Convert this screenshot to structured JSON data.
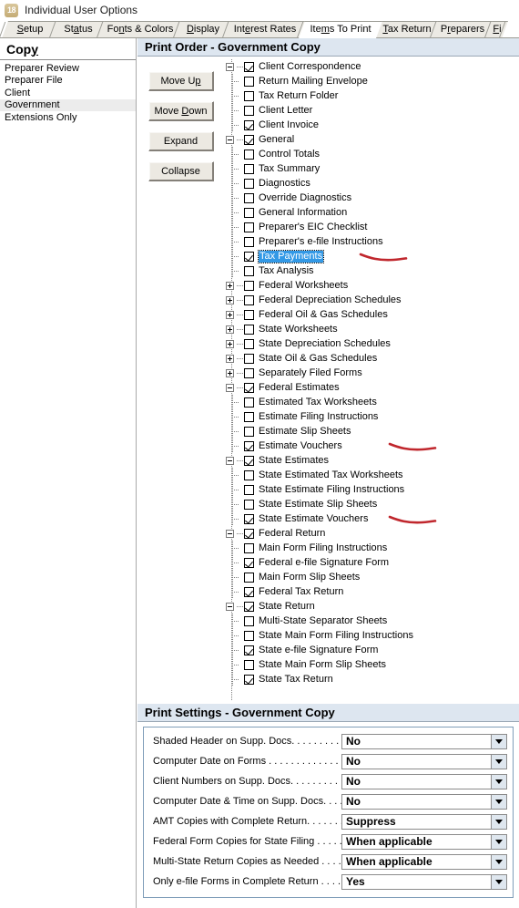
{
  "window": {
    "title": "Individual User Options",
    "icon_name": "app-icon-18",
    "icon_text": "18"
  },
  "tabs": [
    {
      "label": "Setup",
      "accel": "S",
      "active": false
    },
    {
      "label": "Status",
      "accel": "a",
      "active": false
    },
    {
      "label": "Fonts & Colors",
      "accel": "n",
      "active": false
    },
    {
      "label": "Display",
      "accel": "D",
      "active": false
    },
    {
      "label": "Interest Rates",
      "accel": "e",
      "active": false
    },
    {
      "label": "Items To Print",
      "accel": "m",
      "active": true
    },
    {
      "label": "Tax Return",
      "accel": "T",
      "active": false
    },
    {
      "label": "Preparers",
      "accel": "r",
      "active": false
    },
    {
      "label": "Fi",
      "accel": "F",
      "active": false
    }
  ],
  "sidebar": {
    "header": "Copy",
    "header_accel": "y",
    "items": [
      {
        "label": "Preparer Review",
        "selected": false
      },
      {
        "label": "Preparer File",
        "selected": false
      },
      {
        "label": "Client",
        "selected": false
      },
      {
        "label": "Government",
        "selected": true
      },
      {
        "label": "Extensions Only",
        "selected": false
      }
    ]
  },
  "print_order": {
    "title": "Print Order - Government Copy",
    "buttons": [
      {
        "label": "Move Up",
        "accel": "p",
        "name": "move-up-button"
      },
      {
        "label": "Move Down",
        "accel": "D",
        "name": "move-down-button"
      },
      {
        "label": "Expand",
        "accel": "",
        "name": "expand-button"
      },
      {
        "label": "Collapse",
        "accel": "",
        "name": "collapse-button"
      }
    ],
    "tree": [
      {
        "label": "Client Correspondence",
        "level": 0,
        "checked": true,
        "expander": "minus",
        "selected": false,
        "mark": false
      },
      {
        "label": "Return Mailing Envelope",
        "level": 1,
        "checked": false,
        "expander": "none",
        "selected": false,
        "mark": false
      },
      {
        "label": "Tax Return Folder",
        "level": 1,
        "checked": false,
        "expander": "none",
        "selected": false,
        "mark": false
      },
      {
        "label": "Client Letter",
        "level": 1,
        "checked": false,
        "expander": "none",
        "selected": false,
        "mark": false
      },
      {
        "label": "Client Invoice",
        "level": 1,
        "checked": true,
        "expander": "none",
        "selected": false,
        "mark": false
      },
      {
        "label": "General",
        "level": 0,
        "checked": true,
        "expander": "minus",
        "selected": false,
        "mark": false
      },
      {
        "label": "Control Totals",
        "level": 1,
        "checked": false,
        "expander": "none",
        "selected": false,
        "mark": false
      },
      {
        "label": "Tax Summary",
        "level": 1,
        "checked": false,
        "expander": "none",
        "selected": false,
        "mark": false
      },
      {
        "label": "Diagnostics",
        "level": 1,
        "checked": false,
        "expander": "none",
        "selected": false,
        "mark": false
      },
      {
        "label": "Override Diagnostics",
        "level": 1,
        "checked": false,
        "expander": "none",
        "selected": false,
        "mark": false
      },
      {
        "label": "General Information",
        "level": 1,
        "checked": false,
        "expander": "none",
        "selected": false,
        "mark": false
      },
      {
        "label": "Preparer's EIC Checklist",
        "level": 1,
        "checked": false,
        "expander": "none",
        "selected": false,
        "mark": false
      },
      {
        "label": "Preparer's e-file Instructions",
        "level": 1,
        "checked": false,
        "expander": "none",
        "selected": false,
        "mark": false
      },
      {
        "label": "Tax Payments",
        "level": 1,
        "checked": true,
        "expander": "none",
        "selected": true,
        "mark": true
      },
      {
        "label": "Tax Analysis",
        "level": 1,
        "checked": false,
        "expander": "none",
        "selected": false,
        "mark": false
      },
      {
        "label": "Federal Worksheets",
        "level": 0,
        "checked": false,
        "expander": "plus",
        "selected": false,
        "mark": false
      },
      {
        "label": "Federal Depreciation Schedules",
        "level": 0,
        "checked": false,
        "expander": "plus",
        "selected": false,
        "mark": false
      },
      {
        "label": "Federal Oil & Gas Schedules",
        "level": 0,
        "checked": false,
        "expander": "plus",
        "selected": false,
        "mark": false
      },
      {
        "label": "State Worksheets",
        "level": 0,
        "checked": false,
        "expander": "plus",
        "selected": false,
        "mark": false
      },
      {
        "label": "State Depreciation Schedules",
        "level": 0,
        "checked": false,
        "expander": "plus",
        "selected": false,
        "mark": false
      },
      {
        "label": "State Oil & Gas Schedules",
        "level": 0,
        "checked": false,
        "expander": "plus",
        "selected": false,
        "mark": false
      },
      {
        "label": "Separately Filed Forms",
        "level": 0,
        "checked": false,
        "expander": "plus",
        "selected": false,
        "mark": false
      },
      {
        "label": "Federal Estimates",
        "level": 0,
        "checked": true,
        "expander": "minus",
        "selected": false,
        "mark": false
      },
      {
        "label": "Estimated Tax Worksheets",
        "level": 1,
        "checked": false,
        "expander": "none",
        "selected": false,
        "mark": false
      },
      {
        "label": "Estimate Filing Instructions",
        "level": 1,
        "checked": false,
        "expander": "none",
        "selected": false,
        "mark": false
      },
      {
        "label": "Estimate Slip Sheets",
        "level": 1,
        "checked": false,
        "expander": "none",
        "selected": false,
        "mark": false
      },
      {
        "label": "Estimate Vouchers",
        "level": 1,
        "checked": true,
        "expander": "none",
        "selected": false,
        "mark": true
      },
      {
        "label": "State Estimates",
        "level": 0,
        "checked": true,
        "expander": "minus",
        "selected": false,
        "mark": false
      },
      {
        "label": "State Estimated Tax Worksheets",
        "level": 1,
        "checked": false,
        "expander": "none",
        "selected": false,
        "mark": false
      },
      {
        "label": "State Estimate Filing Instructions",
        "level": 1,
        "checked": false,
        "expander": "none",
        "selected": false,
        "mark": false
      },
      {
        "label": "State Estimate Slip Sheets",
        "level": 1,
        "checked": false,
        "expander": "none",
        "selected": false,
        "mark": false
      },
      {
        "label": "State Estimate Vouchers",
        "level": 1,
        "checked": true,
        "expander": "none",
        "selected": false,
        "mark": true
      },
      {
        "label": "Federal Return",
        "level": 0,
        "checked": true,
        "expander": "minus",
        "selected": false,
        "mark": false
      },
      {
        "label": "Main Form Filing Instructions",
        "level": 1,
        "checked": false,
        "expander": "none",
        "selected": false,
        "mark": false
      },
      {
        "label": "Federal e-file Signature Form",
        "level": 1,
        "checked": true,
        "expander": "none",
        "selected": false,
        "mark": false
      },
      {
        "label": "Main Form Slip Sheets",
        "level": 1,
        "checked": false,
        "expander": "none",
        "selected": false,
        "mark": false
      },
      {
        "label": "Federal Tax Return",
        "level": 1,
        "checked": true,
        "expander": "none",
        "selected": false,
        "mark": false
      },
      {
        "label": "State Return",
        "level": 0,
        "checked": true,
        "expander": "minus",
        "selected": false,
        "mark": false
      },
      {
        "label": "Multi-State Separator Sheets",
        "level": 1,
        "checked": false,
        "expander": "none",
        "selected": false,
        "mark": false
      },
      {
        "label": "State Main Form Filing Instructions",
        "level": 1,
        "checked": false,
        "expander": "none",
        "selected": false,
        "mark": false
      },
      {
        "label": "State e-file Signature Form",
        "level": 1,
        "checked": true,
        "expander": "none",
        "selected": false,
        "mark": false
      },
      {
        "label": "State Main Form Slip Sheets",
        "level": 1,
        "checked": false,
        "expander": "none",
        "selected": false,
        "mark": false
      },
      {
        "label": "State Tax Return",
        "level": 1,
        "checked": true,
        "expander": "none",
        "selected": false,
        "mark": false
      }
    ]
  },
  "print_settings": {
    "title": "Print Settings - Government Copy",
    "rows": [
      {
        "label": "Shaded Header on Supp. Docs. . . . . . . . .",
        "value": "No"
      },
      {
        "label": "Computer Date on Forms . . . . . . . . . . . . .",
        "value": "No"
      },
      {
        "label": "Client Numbers on Supp. Docs. . . . . . . . .",
        "value": "No"
      },
      {
        "label": "Computer Date & Time on Supp. Docs. . . .",
        "value": "No"
      },
      {
        "label": "AMT Copies with Complete Return. . . . . . .",
        "value": "Suppress"
      },
      {
        "label": "Federal Form Copies for State Filing . . . . . .",
        "value": "When applicable"
      },
      {
        "label": "Multi-State Return Copies as Needed . . . .",
        "value": "When applicable"
      },
      {
        "label": "Only e-file Forms in Complete Return . . . . .",
        "value": "Yes"
      }
    ]
  },
  "colors": {
    "section_header_bg": "#dde6f0",
    "selection_blue": "#3399e6",
    "annotation_red": "#c0272d",
    "sidebar_selected_bg": "#ececec",
    "button_face": "#ece9e2"
  }
}
